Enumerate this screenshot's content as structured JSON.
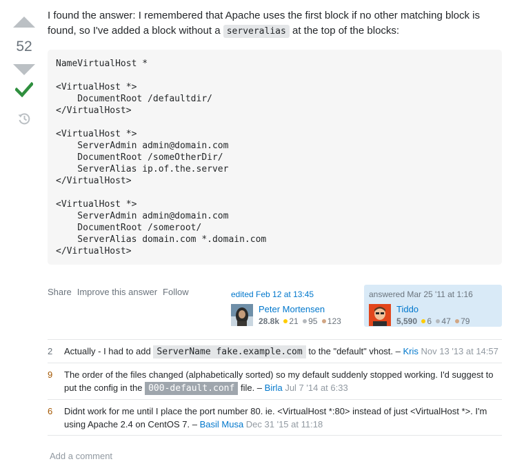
{
  "vote": {
    "score": "52"
  },
  "answer": {
    "intro_before": "I found the answer: I remembered that Apache uses the first block if no other matching block is found, so I've added a block without a",
    "intro_code": "serveralias",
    "intro_after": "at the top of the blocks:",
    "code": "NameVirtualHost *\n\n<VirtualHost *>\n    DocumentRoot /defaultdir/\n</VirtualHost>\n\n<VirtualHost *>\n    ServerAdmin admin@domain.com\n    DocumentRoot /someOtherDir/\n    ServerAlias ip.of.the.server\n</VirtualHost>\n\n<VirtualHost *>\n    ServerAdmin admin@domain.com\n    DocumentRoot /someroot/\n    ServerAlias domain.com *.domain.com\n</VirtualHost>"
  },
  "menu": {
    "share": "Share",
    "improve": "Improve this answer",
    "follow": "Follow"
  },
  "editor": {
    "when": "edited Feb 12 at 13:45",
    "name": "Peter Mortensen",
    "rep": "28.8k",
    "gold": "21",
    "silver": "95",
    "bronze": "123"
  },
  "owner": {
    "when": "answered Mar 25 '11 at 1:16",
    "name": "Tiddo",
    "rep": "5,590",
    "gold": "6",
    "silver": "47",
    "bronze": "79"
  },
  "comments": [
    {
      "score": "2",
      "before": "Actually - I had to add",
      "code": "ServerName fake.example.com",
      "after": "to the \"default\" vhost. –",
      "user": "Kris",
      "date": "Nov 13 '13 at 14:57"
    },
    {
      "score": "9",
      "before": "The order of the files changed (alphabetically sorted) so my default suddenly stopped working. I'd suggest to put the config in the",
      "code": "000-default.conf",
      "after": "file. –",
      "user": "Birla",
      "date": "Jul 7 '14 at 6:33"
    },
    {
      "score": "6",
      "text": "Didnt work for me until I place the port number 80. ie. <VirtualHost *:80> instead of just <VirtualHost *>. I'm using Apache 2.4 on CentOS 7. –",
      "user": "Basil Musa",
      "date": "Dec 31 '15 at 11:18"
    }
  ],
  "add_comment": "Add a comment",
  "colors": {
    "link": "#0077cc",
    "accepted": "#2f8f3e",
    "owner_bg": "#d9eaf7",
    "code_bg": "#f6f6f6"
  },
  "icons": [
    "vote-up-icon",
    "vote-down-icon",
    "accepted-check-icon",
    "history-icon"
  ]
}
